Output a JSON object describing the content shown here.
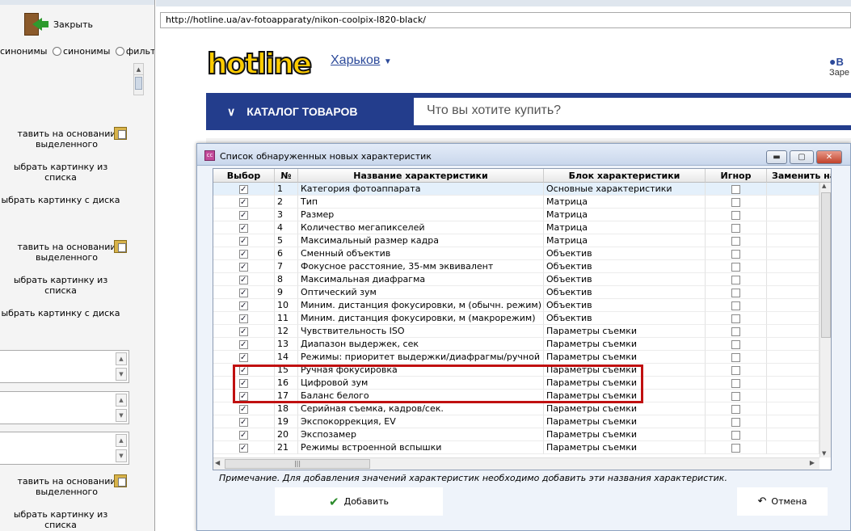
{
  "left_panel": {
    "close_label": "Закрыть",
    "radio1": "синонимы",
    "radio2": "синонимы",
    "radio3": "фильтр",
    "btn_based1": "тавить на основании выделенного",
    "btn_pick_list1": "ыбрать картинку из списка",
    "btn_pick_disk1": "ыбрать картинку с диска",
    "btn_based2": "тавить на основании выделенного",
    "btn_pick_list2": "ыбрать картинку из списка",
    "btn_pick_disk2": "ыбрать картинку с диска",
    "btn_based3": "тавить на основании выделенного",
    "btn_pick_list3": "ыбрать картинку из списка"
  },
  "browser": {
    "url": "http://hotline.ua/av-fotoapparaty/nikon-coolpix-l820-black/",
    "logo": "hotline",
    "city": "Харьков",
    "user_short": "В",
    "user_link": "Заре",
    "catalog": "КАТАЛОГ ТОВАРОВ",
    "search_placeholder": "Что вы хотите купить?"
  },
  "dialog": {
    "title": "Список обнаруженных новых характеристик",
    "app_icon": "cc",
    "columns": [
      "Выбор",
      "№",
      "Название характеристики",
      "Блок характеристики",
      "Игнор",
      "Заменить на"
    ],
    "rows": [
      {
        "n": "1",
        "name": "Категория фотоаппарата",
        "block": "Основные характеристики"
      },
      {
        "n": "2",
        "name": "Тип",
        "block": "Матрица"
      },
      {
        "n": "3",
        "name": "Размер",
        "block": "Матрица"
      },
      {
        "n": "4",
        "name": "Количество мегапикселей",
        "block": "Матрица"
      },
      {
        "n": "5",
        "name": "Максимальный размер кадра",
        "block": "Матрица"
      },
      {
        "n": "6",
        "name": "Сменный объектив",
        "block": "Объектив"
      },
      {
        "n": "7",
        "name": "Фокусное расстояние, 35-мм эквивалент",
        "block": "Объектив"
      },
      {
        "n": "8",
        "name": "Максимальная диафрагма",
        "block": "Объектив"
      },
      {
        "n": "9",
        "name": "Оптический зум",
        "block": "Объектив"
      },
      {
        "n": "10",
        "name": "Миним. дистанция фокусировки, м (обычн. режим)",
        "block": "Объектив"
      },
      {
        "n": "11",
        "name": "Миним. дистанция фокусировки, м (макрорежим)",
        "block": "Объектив"
      },
      {
        "n": "12",
        "name": "Чувствительность ISO",
        "block": "Параметры съемки"
      },
      {
        "n": "13",
        "name": "Диапазон выдержек, сек",
        "block": "Параметры съемки"
      },
      {
        "n": "14",
        "name": "Режимы: приоритет выдержки/диафрагмы/ручной",
        "block": "Параметры съемки"
      },
      {
        "n": "15",
        "name": "Ручная фокусировка",
        "block": "Параметры съемки"
      },
      {
        "n": "16",
        "name": "Цифровой зум",
        "block": "Параметры съемки"
      },
      {
        "n": "17",
        "name": "Баланс белого",
        "block": "Параметры съемки"
      },
      {
        "n": "18",
        "name": "Серийная съемка, кадров/сек.",
        "block": "Параметры съемки"
      },
      {
        "n": "19",
        "name": "Экспокоррекция, EV",
        "block": "Параметры съемки"
      },
      {
        "n": "20",
        "name": "Экспозамер",
        "block": "Параметры съемки"
      },
      {
        "n": "21",
        "name": "Режимы встроенной вспышки",
        "block": "Параметры съемки"
      }
    ],
    "hscroll_grip": "|||",
    "note": "Примечание. Для добавления значений характеристик необходимо добавить эти названия характеристик.",
    "add_label": "Добавить",
    "cancel_label": "Отмена"
  }
}
